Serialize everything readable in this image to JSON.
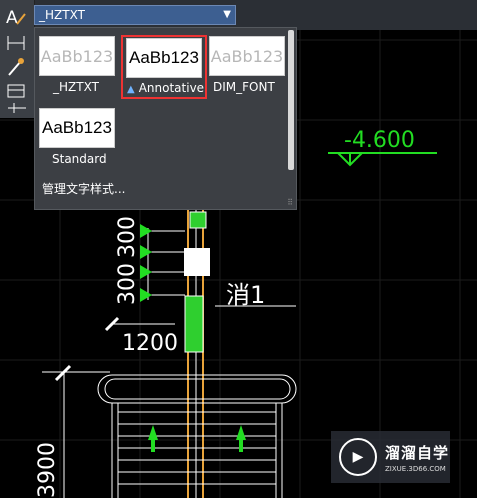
{
  "style_combo": {
    "value": "_HZTXT"
  },
  "styles": [
    {
      "preview": "AaBb123",
      "name": "_HZTXT"
    },
    {
      "preview": "AaBb123",
      "name": "Annotative"
    },
    {
      "preview": "AaBb123",
      "name": "DIM_FONT"
    },
    {
      "preview": "AaBb123",
      "name": "Standard"
    }
  ],
  "manage_label": "管理文字样式...",
  "drawing": {
    "elevation": "-4.600",
    "dims_vertical": [
      "300",
      "300"
    ],
    "dim_1200": "1200",
    "dim_3900": "3900",
    "label_xiao": "消1"
  },
  "watermark": {
    "title": "溜溜自学",
    "url": "ZIXUE.3D66.COM"
  },
  "colors": {
    "accent_red": "#e33333",
    "cad_green": "#22dd22",
    "combo_blue": "#3d5f91"
  }
}
